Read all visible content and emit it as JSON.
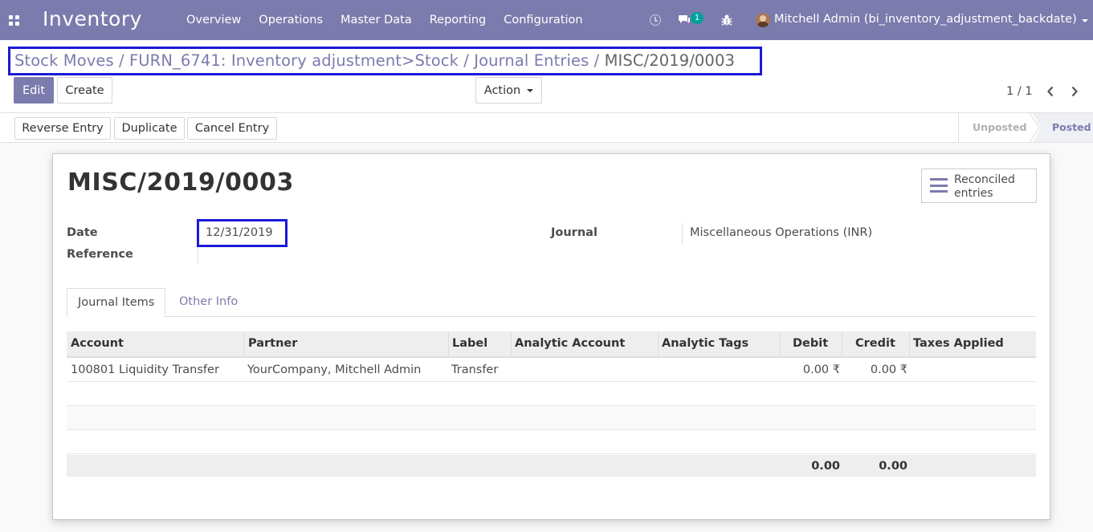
{
  "app": {
    "title": "Inventory"
  },
  "menu": [
    "Overview",
    "Operations",
    "Master Data",
    "Reporting",
    "Configuration"
  ],
  "systray": {
    "message_count": "1",
    "user": "Mitchell Admin (bi_inventory_adjustment_backdate)"
  },
  "breadcrumb": {
    "path": "Stock Moves / FURN_6741: Inventory adjustment>Stock / Journal Entries / ",
    "current": "MISC/2019/0003"
  },
  "buttons": {
    "edit": "Edit",
    "create": "Create",
    "action": "Action"
  },
  "pager": {
    "text": "1 / 1"
  },
  "header_buttons": {
    "reverse": "Reverse Entry",
    "duplicate": "Duplicate",
    "cancel": "Cancel Entry"
  },
  "status": {
    "unposted": "Unposted",
    "posted": "Posted",
    "current": "Posted"
  },
  "record": {
    "name": "MISC/2019/0003",
    "smart_button": "Reconciled entries",
    "fields": {
      "date_label": "Date",
      "date_value": "12/31/2019",
      "reference_label": "Reference",
      "reference_value": "",
      "journal_label": "Journal",
      "journal_value": "Miscellaneous Operations (INR)"
    }
  },
  "tabs": {
    "journal_items": "Journal Items",
    "other_info": "Other Info",
    "active": "Journal Items"
  },
  "table": {
    "columns": [
      "Account",
      "Partner",
      "Label",
      "Analytic Account",
      "Analytic Tags",
      "Debit",
      "Credit",
      "Taxes Applied"
    ],
    "rows": [
      {
        "account": "100801 Liquidity Transfer",
        "partner": "YourCompany, Mitchell Admin",
        "label": "Transfer",
        "analytic_account": "",
        "analytic_tags": "",
        "debit": "0.00 ₹",
        "credit": "0.00 ₹",
        "taxes": ""
      }
    ],
    "totals": {
      "debit": "0.00",
      "credit": "0.00"
    }
  },
  "colors": {
    "brand": "#7c7bad",
    "highlight_box": "#1a1ad8",
    "badge": "#00a09d"
  }
}
